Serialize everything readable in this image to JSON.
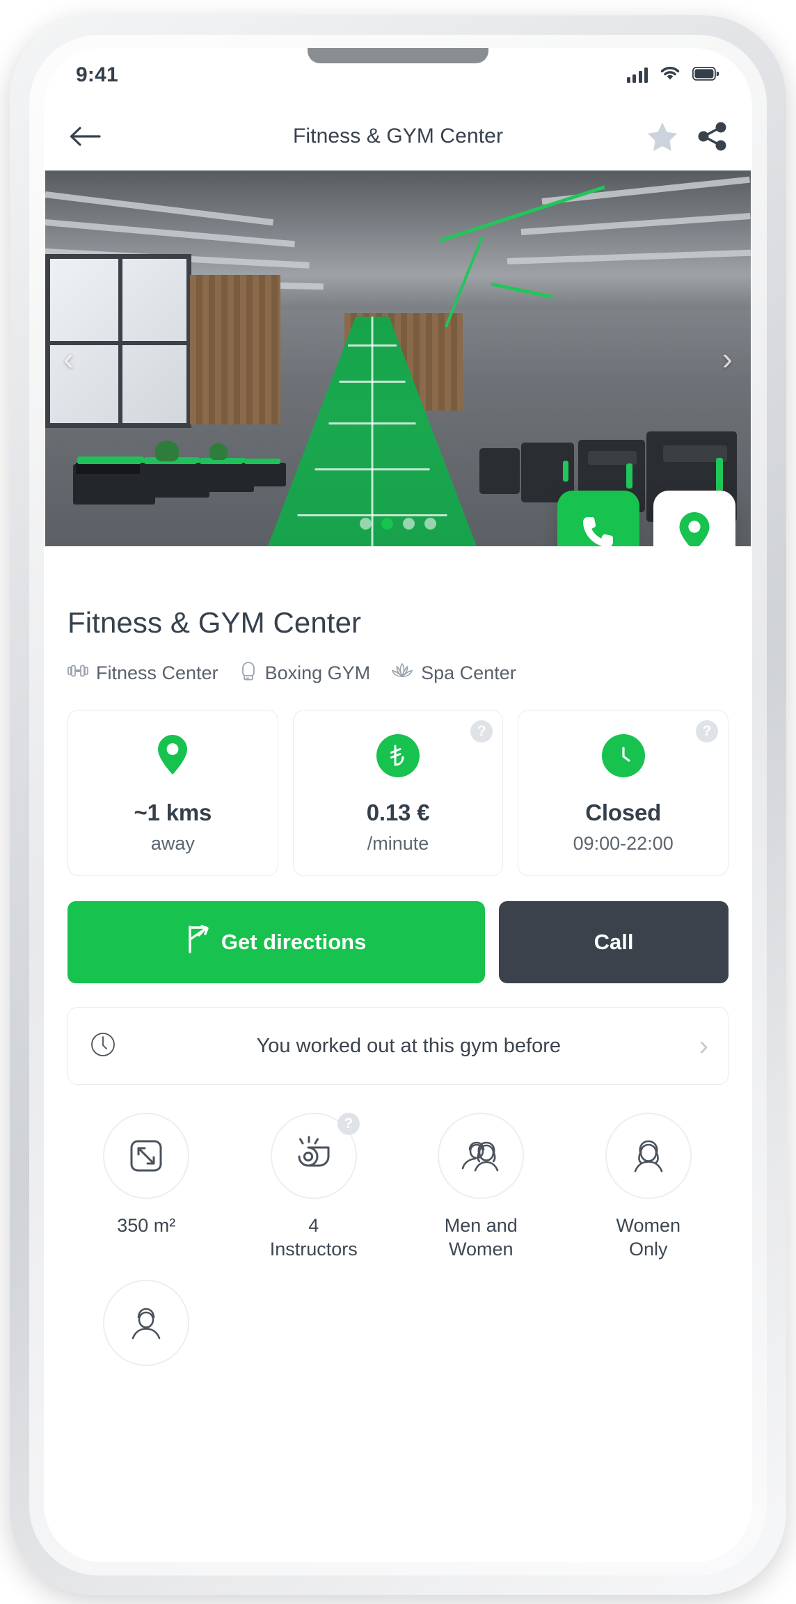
{
  "status_bar": {
    "time": "9:41",
    "signal_icon": "cellular-signal-icon",
    "wifi_icon": "wifi-icon",
    "battery_icon": "battery-full-icon"
  },
  "navbar": {
    "back_icon": "back-arrow-icon",
    "title": "Fitness & GYM Center",
    "favorite_icon": "star-icon",
    "share_icon": "share-icon"
  },
  "hero": {
    "prev_arrow": "‹",
    "next_arrow": "›",
    "dots_total": 4,
    "active_dot": 2,
    "call_fab_icon": "phone-icon",
    "map_fab_icon": "map-pin-icon"
  },
  "venue": {
    "name": "Fitness & GYM Center",
    "tags": [
      {
        "icon": "dumbbell-icon",
        "label": "Fitness Center"
      },
      {
        "icon": "boxing-glove-icon",
        "label": "Boxing GYM"
      },
      {
        "icon": "lotus-icon",
        "label": "Spa Center"
      }
    ]
  },
  "info_cards": [
    {
      "icon": "map-pin-icon",
      "main": "~1 kms",
      "sub": "away",
      "help": false,
      "help_label": "?"
    },
    {
      "icon": "turkish-lira-icon",
      "main": "0.13 €",
      "sub": "/minute",
      "help": true,
      "help_label": "?"
    },
    {
      "icon": "clock-icon",
      "main": "Closed",
      "sub": "09:00-22:00",
      "help": true,
      "help_label": "?"
    }
  ],
  "actions": {
    "directions_label": "Get directions",
    "directions_icon": "turn-right-arrow-icon",
    "call_label": "Call"
  },
  "history": {
    "icon": "clock-outline-icon",
    "text": "You worked out at this gym before",
    "chevron": "›"
  },
  "features": [
    {
      "icon": "area-resize-icon",
      "label": "350 m²",
      "help": false,
      "help_label": "?"
    },
    {
      "icon": "whistle-icon",
      "label": "4\nInstructors",
      "help": true,
      "help_label": "?"
    },
    {
      "icon": "men-and-women-icon",
      "label": "Men and\nWomen",
      "help": false,
      "help_label": "?"
    },
    {
      "icon": "woman-icon",
      "label": "Women\nOnly",
      "help": false,
      "help_label": "?"
    },
    {
      "icon": "man-icon",
      "label": "",
      "help": false,
      "help_label": "?"
    }
  ],
  "colors": {
    "accent_green": "#17c24e",
    "dark": "#3b424c",
    "text": "#36414d",
    "muted": "#5d6670",
    "border": "#e9ebee"
  }
}
